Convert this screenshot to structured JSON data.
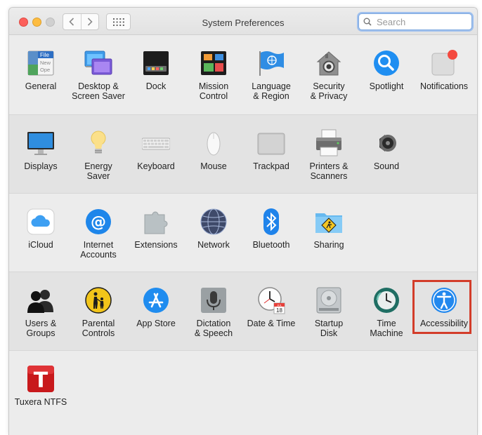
{
  "window": {
    "title": "System Preferences"
  },
  "search": {
    "placeholder": "Search"
  },
  "sections": [
    {
      "items": [
        {
          "label": "General"
        },
        {
          "label": "Desktop &\nScreen Saver"
        },
        {
          "label": "Dock"
        },
        {
          "label": "Mission\nControl"
        },
        {
          "label": "Language\n& Region"
        },
        {
          "label": "Security\n& Privacy"
        },
        {
          "label": "Spotlight"
        },
        {
          "label": "Notifications"
        }
      ]
    },
    {
      "items": [
        {
          "label": "Displays"
        },
        {
          "label": "Energy\nSaver"
        },
        {
          "label": "Keyboard"
        },
        {
          "label": "Mouse"
        },
        {
          "label": "Trackpad"
        },
        {
          "label": "Printers &\nScanners"
        },
        {
          "label": "Sound"
        }
      ]
    },
    {
      "items": [
        {
          "label": "iCloud"
        },
        {
          "label": "Internet\nAccounts"
        },
        {
          "label": "Extensions"
        },
        {
          "label": "Network"
        },
        {
          "label": "Bluetooth"
        },
        {
          "label": "Sharing"
        }
      ]
    },
    {
      "items": [
        {
          "label": "Users &\nGroups"
        },
        {
          "label": "Parental\nControls"
        },
        {
          "label": "App Store"
        },
        {
          "label": "Dictation\n& Speech"
        },
        {
          "label": "Date & Time"
        },
        {
          "label": "Startup\nDisk"
        },
        {
          "label": "Time\nMachine"
        },
        {
          "label": "Accessibility"
        }
      ]
    },
    {
      "items": [
        {
          "label": "Tuxera NTFS"
        }
      ]
    }
  ],
  "general_icon_text": [
    "File",
    "New",
    "Ope"
  ],
  "date_icon_text": {
    "month": "JUL",
    "day": "18"
  },
  "colors": {
    "highlight": "#d33d2a",
    "search_focus": "#7fa9df"
  }
}
